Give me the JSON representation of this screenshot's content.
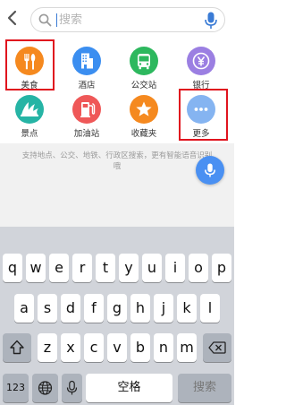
{
  "search": {
    "placeholder": "搜索"
  },
  "icons": {
    "back": "chevron-left-icon",
    "search": "search-icon",
    "mic": "microphone-icon"
  },
  "colors": {
    "accent": "#3a7bd5",
    "highlight": "#e0141e",
    "food": "#f5891f",
    "hotel": "#3b8ef0",
    "bus": "#2db85e",
    "bank": "#9b7fe2",
    "scenic": "#26b4a5",
    "gas": "#ef5858",
    "favorites": "#f5891f",
    "more": "#85b4f1",
    "voice": "#4a90f2"
  },
  "categories": [
    {
      "label": "美食",
      "icon": "fork-knife-icon"
    },
    {
      "label": "酒店",
      "icon": "hotel-building-icon"
    },
    {
      "label": "公交站",
      "icon": "bus-icon"
    },
    {
      "label": "银行",
      "icon": "yen-icon"
    },
    {
      "label": "景点",
      "icon": "opera-house-icon"
    },
    {
      "label": "加油站",
      "icon": "gas-pump-icon"
    },
    {
      "label": "收藏夹",
      "icon": "star-icon"
    },
    {
      "label": "更多",
      "icon": "more-dots-icon"
    }
  ],
  "hint": "支持地点、公交、地铁、行政区搜索，更有智能语音识别哦",
  "keyboard": {
    "row1": [
      "q",
      "w",
      "e",
      "r",
      "t",
      "y",
      "u",
      "i",
      "o",
      "p"
    ],
    "row2": [
      "a",
      "s",
      "d",
      "f",
      "g",
      "h",
      "j",
      "k",
      "l"
    ],
    "row3": [
      "z",
      "x",
      "c",
      "v",
      "b",
      "n",
      "m"
    ],
    "numbers_label": "123",
    "space_label": "空格",
    "search_label": "搜索",
    "shift_icon": "shift-icon",
    "delete_icon": "backspace-icon",
    "globe_icon": "globe-icon",
    "dictation_icon": "microphone-icon"
  }
}
